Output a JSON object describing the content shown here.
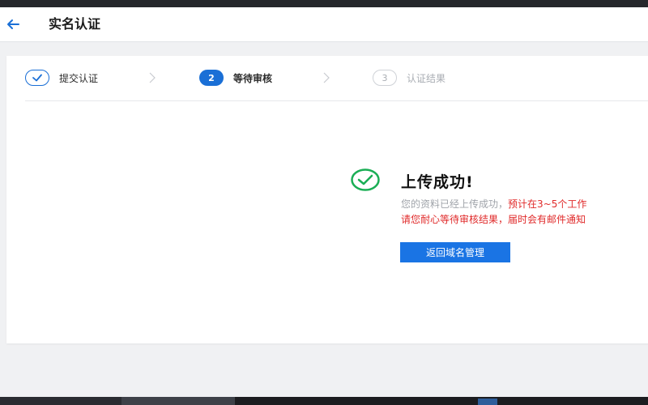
{
  "header": {
    "title": "实名认证",
    "back_icon": "arrow-left-icon"
  },
  "steps": [
    {
      "index": "1",
      "label": "提交认证",
      "status": "done",
      "icon": "check-icon"
    },
    {
      "index": "2",
      "label": "等待审核",
      "status": "active"
    },
    {
      "index": "3",
      "label": "认证结果",
      "status": "wait"
    }
  ],
  "result": {
    "icon": "check-circle-icon",
    "headline": "上传成功!",
    "line1_gray": "您的资料已经上传成功，",
    "line1_red": "预计在3~5个工作",
    "line2_red1": "请您耐心等待审核结果，",
    "line2_red2": "届时会有邮件通知"
  },
  "button": {
    "label": "返回域名管理"
  },
  "colors": {
    "primary": "#1a74e4",
    "success": "#1aae55",
    "warning_text": "#e02a2a"
  }
}
